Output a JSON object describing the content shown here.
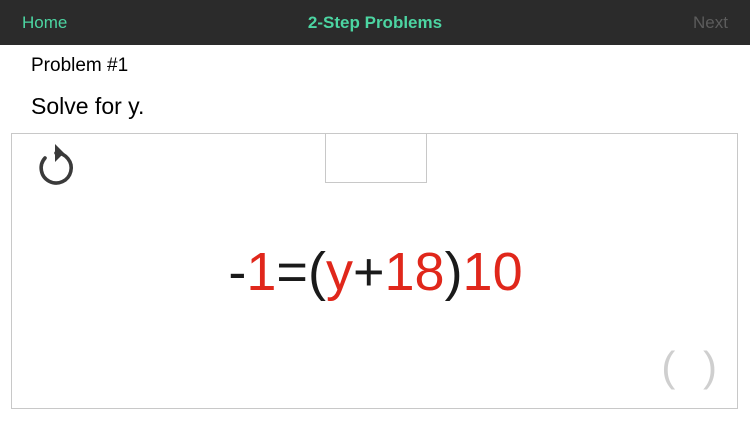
{
  "navbar": {
    "home_label": "Home",
    "title": "2-Step Problems",
    "next_label": "Next"
  },
  "problem": {
    "number_label": "Problem #1",
    "instruction": "Solve for y."
  },
  "equation": {
    "tokens": {
      "minus": "-",
      "one": "1",
      "equals": "=",
      "open_paren": "(",
      "variable": "y",
      "plus": "+",
      "eighteen": "18",
      "close_paren": ")",
      "ten": "10"
    }
  },
  "tools": {
    "paren_label": "( )",
    "undo_icon": "undo-icon"
  },
  "colors": {
    "nav_background": "#2b2b2b",
    "nav_accent": "#4cd5a2",
    "nav_disabled": "#5c5c5c",
    "number_red": "#e0271b",
    "operator_black": "#1a1a1a"
  }
}
